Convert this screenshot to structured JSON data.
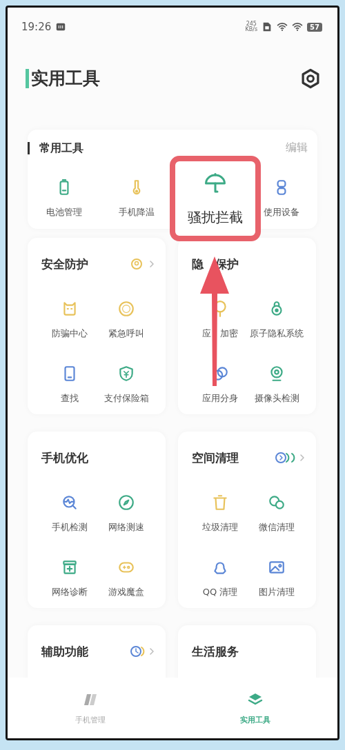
{
  "status_bar": {
    "time": "19:26",
    "speed_value": "245",
    "speed_unit": "KB/s",
    "battery": "57"
  },
  "header": {
    "title": "实用工具"
  },
  "common_tools": {
    "title": "常用工具",
    "edit": "编辑",
    "items": [
      {
        "label": "电池管理",
        "highlighted": false
      },
      {
        "label": "手机降温",
        "highlighted": false
      },
      {
        "label": "骚扰拦截",
        "highlighted": true
      },
      {
        "label": "使用设备",
        "highlighted": false
      }
    ]
  },
  "sections": [
    {
      "title": "安全防护",
      "items": [
        {
          "label": "防骗中心"
        },
        {
          "label": "紧急呼叫"
        },
        {
          "label": "查找"
        },
        {
          "label": "支付保险箱"
        }
      ]
    },
    {
      "title": "隐　保护",
      "items": [
        {
          "label": "应　加密"
        },
        {
          "label": "原子隐私系统"
        },
        {
          "label": "应用分身"
        },
        {
          "label": "摄像头检测"
        }
      ]
    },
    {
      "title": "手机优化",
      "items": [
        {
          "label": "手机检测"
        },
        {
          "label": "网络测速"
        },
        {
          "label": "网络诊断"
        },
        {
          "label": "游戏魔盒"
        }
      ]
    },
    {
      "title": "空间清理",
      "items": [
        {
          "label": "垃圾清理"
        },
        {
          "label": "微信清理"
        },
        {
          "label": "QQ 清理"
        },
        {
          "label": "图片清理"
        }
      ]
    },
    {
      "title": "辅助功能"
    },
    {
      "title": "生活服务"
    }
  ],
  "bottom_nav": [
    {
      "label": "手机管理",
      "selected": false
    },
    {
      "label": "实用工具",
      "selected": true
    }
  ]
}
